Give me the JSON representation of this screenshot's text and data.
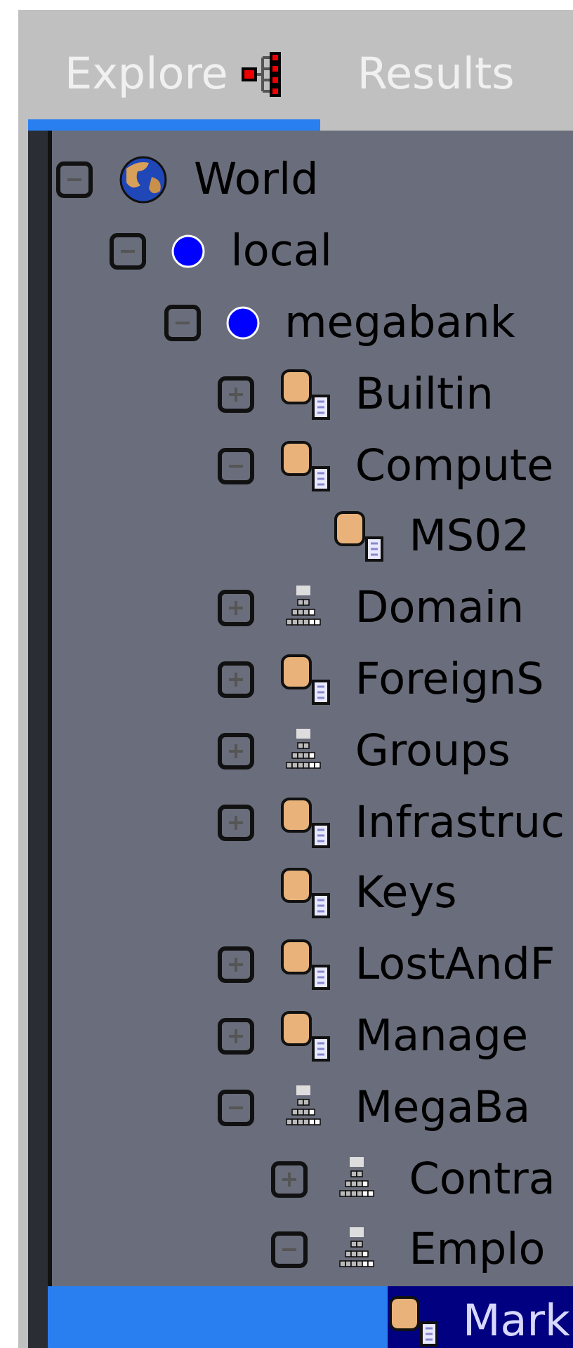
{
  "tabs": [
    {
      "label": "Explore",
      "selected": true,
      "icon": true
    },
    {
      "label": "Results",
      "selected": false,
      "icon": false
    }
  ],
  "tree": [
    {
      "label": "World",
      "kind": "world",
      "expanded": true,
      "selected": false,
      "children": [
        {
          "label": "local",
          "kind": "domain",
          "expanded": true,
          "selected": false,
          "children": [
            {
              "label": "megabank",
              "kind": "domain",
              "expanded": true,
              "selected": false,
              "children": [
                {
                  "label": "Builtin",
                  "kind": "container",
                  "expanded": false,
                  "selected": false
                },
                {
                  "label": "Compute",
                  "kind": "container",
                  "expanded": true,
                  "selected": false,
                  "children": [
                    {
                      "label": "MS02",
                      "kind": "container",
                      "selected": false
                    }
                  ]
                },
                {
                  "label": "Domain",
                  "kind": "ou",
                  "expanded": false,
                  "selected": false
                },
                {
                  "label": "ForeignS",
                  "kind": "container",
                  "expanded": false,
                  "selected": false
                },
                {
                  "label": "Groups",
                  "kind": "ou",
                  "expanded": false,
                  "selected": false
                },
                {
                  "label": "Infrastruc",
                  "kind": "container",
                  "expanded": false,
                  "selected": false
                },
                {
                  "label": "Keys",
                  "kind": "container",
                  "selected": false
                },
                {
                  "label": "LostAndF",
                  "kind": "container",
                  "expanded": false,
                  "selected": false
                },
                {
                  "label": "Manage",
                  "kind": "container",
                  "expanded": false,
                  "selected": false
                },
                {
                  "label": "MegaBa",
                  "kind": "ou",
                  "expanded": true,
                  "selected": false,
                  "children": [
                    {
                      "label": "Contra",
                      "kind": "ou",
                      "expanded": false,
                      "selected": false
                    },
                    {
                      "label": "Emplo",
                      "kind": "ou",
                      "expanded": true,
                      "selected": false,
                      "children": [
                        {
                          "label": "Mark",
                          "kind": "container",
                          "selected": true
                        }
                      ]
                    }
                  ]
                }
              ]
            }
          ]
        }
      ]
    }
  ]
}
